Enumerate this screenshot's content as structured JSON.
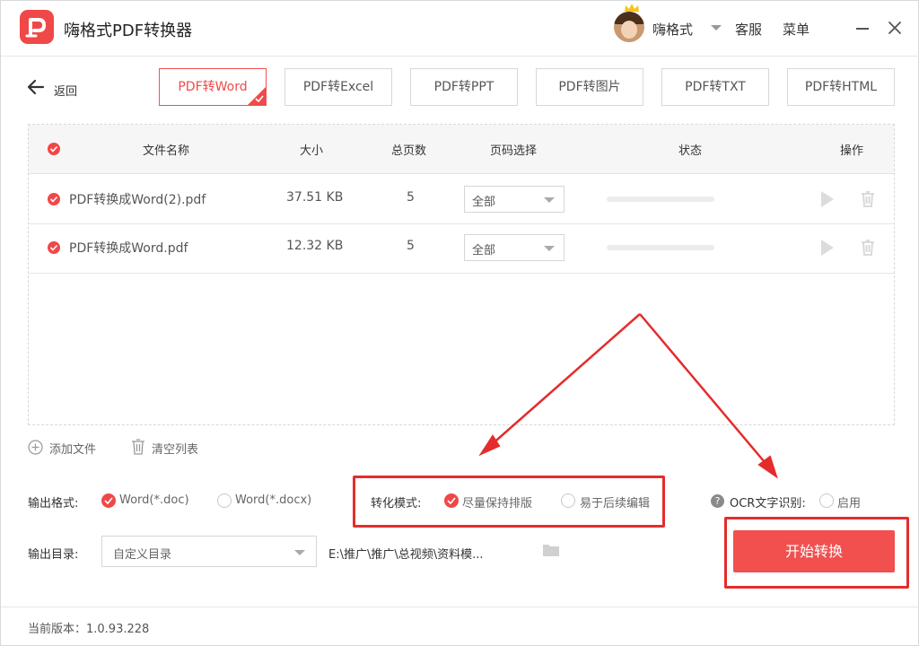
{
  "app": {
    "title": "嗨格式PDF转换器",
    "user_name": "嗨格式",
    "service": "客服",
    "menu": "菜单"
  },
  "nav": {
    "back_label": "返回",
    "tabs": [
      {
        "label": "PDF转Word",
        "active": true
      },
      {
        "label": "PDF转Excel",
        "active": false
      },
      {
        "label": "PDF转PPT",
        "active": false
      },
      {
        "label": "PDF转图片",
        "active": false
      },
      {
        "label": "PDF转TXT",
        "active": false
      },
      {
        "label": "PDF转HTML",
        "active": false
      }
    ]
  },
  "table": {
    "headers": {
      "name": "文件名称",
      "size": "大小",
      "pages": "总页数",
      "page_select": "页码选择",
      "status": "状态",
      "actions": "操作"
    },
    "rows": [
      {
        "name": "PDF转换成Word(2).pdf",
        "size": "37.51 KB",
        "pages": "5",
        "page_select": "全部"
      },
      {
        "name": "PDF转换成Word.pdf",
        "size": "12.32 KB",
        "pages": "5",
        "page_select": "全部"
      }
    ]
  },
  "toolbar": {
    "add_file": "添加文件",
    "clear_list": "清空列表"
  },
  "output": {
    "format_label": "输出格式:",
    "format_options": [
      "Word(*.doc)",
      "Word(*.docx)"
    ],
    "format_selected": "Word(*.doc)",
    "mode_label": "转化模式:",
    "mode_options": [
      "尽量保持排版",
      "易于后续编辑"
    ],
    "mode_selected": "尽量保持排版",
    "ocr_label": "OCR文字识别:",
    "ocr_option": "启用",
    "help_glyph": "?",
    "dir_label": "输出目录:",
    "dir_select": "自定义目录",
    "dir_path": "E:\\推广\\推广\\总视频\\资料模..."
  },
  "start_button": "开始转换",
  "footer": {
    "version": "当前版本：1.0.93.228"
  },
  "colors": {
    "accent": "#f04848",
    "annotation": "#e52c2c"
  }
}
